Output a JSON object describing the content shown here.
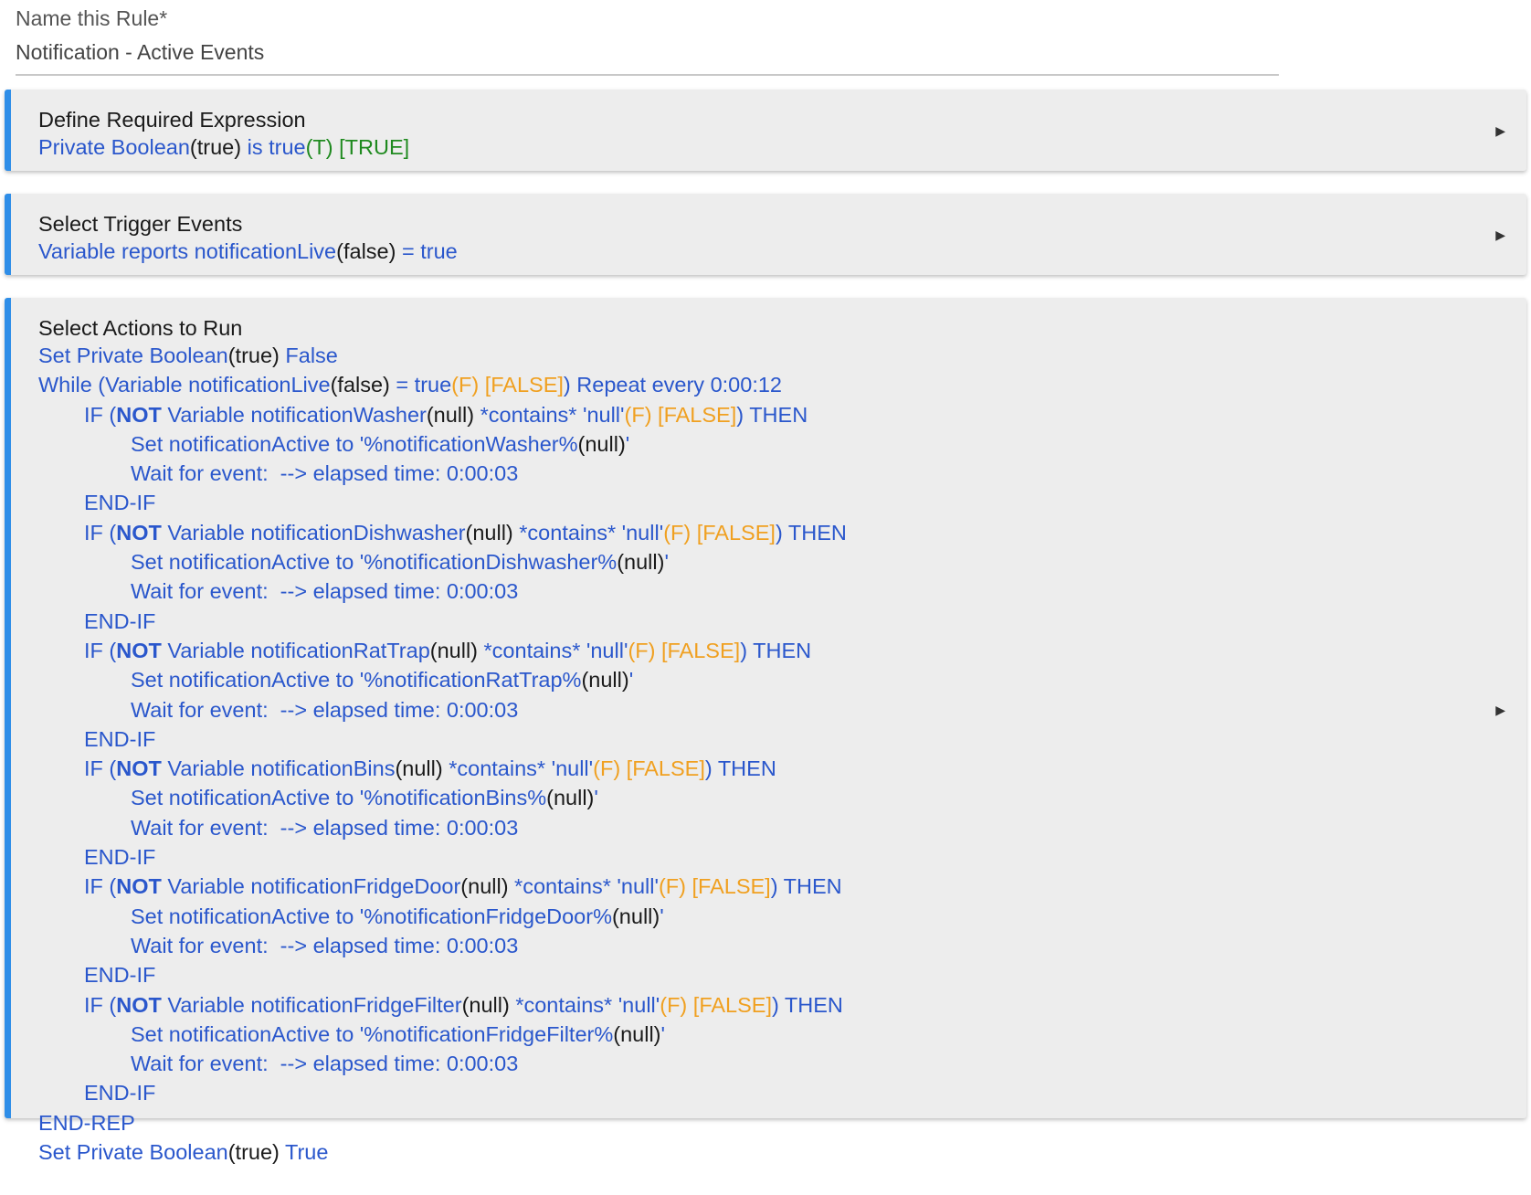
{
  "name_rule": {
    "label": "Name this Rule*",
    "value": "Notification - Active Events"
  },
  "required_expression": {
    "title": "Define Required Expression",
    "segments": [
      {
        "t": "Private Boolean",
        "c": "b"
      },
      {
        "t": "(true)",
        "c": "k"
      },
      {
        "t": " is true",
        "c": "b"
      },
      {
        "t": "(T) [TRUE]",
        "c": "g"
      }
    ]
  },
  "trigger_events": {
    "title": "Select Trigger Events",
    "segments": [
      {
        "t": "Variable reports notificationLive",
        "c": "b"
      },
      {
        "t": "(false)",
        "c": "k"
      },
      {
        "t": " = true",
        "c": "b"
      }
    ]
  },
  "actions": {
    "title": "Select Actions to Run",
    "lines": [
      {
        "indent": 0,
        "segments": [
          {
            "t": "Set Private Boolean",
            "c": "b"
          },
          {
            "t": "(true)",
            "c": "k"
          },
          {
            "t": " False",
            "c": "b"
          }
        ]
      },
      {
        "indent": 0,
        "segments": [
          {
            "t": "While (Variable notificationLive",
            "c": "b"
          },
          {
            "t": "(false)",
            "c": "k"
          },
          {
            "t": " = true",
            "c": "b"
          },
          {
            "t": "(F) [FALSE]",
            "c": "o"
          },
          {
            "t": ") Repeat every 0:00:12",
            "c": "b"
          }
        ]
      },
      {
        "indent": 1,
        "segments": [
          {
            "t": "IF (",
            "c": "b"
          },
          {
            "t": "NOT",
            "c": "b bold"
          },
          {
            "t": " Variable notificationWasher",
            "c": "b"
          },
          {
            "t": "(null)",
            "c": "k"
          },
          {
            "t": " *contains* 'null'",
            "c": "b"
          },
          {
            "t": "(F) [FALSE]",
            "c": "o"
          },
          {
            "t": ") THEN",
            "c": "b"
          }
        ]
      },
      {
        "indent": 2,
        "segments": [
          {
            "t": "Set notificationActive to '%notificationWasher%",
            "c": "b"
          },
          {
            "t": "(null)",
            "c": "k"
          },
          {
            "t": "'",
            "c": "b"
          }
        ]
      },
      {
        "indent": 2,
        "segments": [
          {
            "t": "Wait for event:  --> elapsed time: 0:00:03",
            "c": "b"
          }
        ]
      },
      {
        "indent": 1,
        "segments": [
          {
            "t": "END-IF",
            "c": "b"
          }
        ]
      },
      {
        "indent": 1,
        "segments": [
          {
            "t": "IF (",
            "c": "b"
          },
          {
            "t": "NOT",
            "c": "b bold"
          },
          {
            "t": " Variable notificationDishwasher",
            "c": "b"
          },
          {
            "t": "(null)",
            "c": "k"
          },
          {
            "t": " *contains* 'null'",
            "c": "b"
          },
          {
            "t": "(F) [FALSE]",
            "c": "o"
          },
          {
            "t": ") THEN",
            "c": "b"
          }
        ]
      },
      {
        "indent": 2,
        "segments": [
          {
            "t": "Set notificationActive to '%notificationDishwasher%",
            "c": "b"
          },
          {
            "t": "(null)",
            "c": "k"
          },
          {
            "t": "'",
            "c": "b"
          }
        ]
      },
      {
        "indent": 2,
        "segments": [
          {
            "t": "Wait for event:  --> elapsed time: 0:00:03",
            "c": "b"
          }
        ]
      },
      {
        "indent": 1,
        "segments": [
          {
            "t": "END-IF",
            "c": "b"
          }
        ]
      },
      {
        "indent": 1,
        "segments": [
          {
            "t": "IF (",
            "c": "b"
          },
          {
            "t": "NOT",
            "c": "b bold"
          },
          {
            "t": " Variable notificationRatTrap",
            "c": "b"
          },
          {
            "t": "(null)",
            "c": "k"
          },
          {
            "t": " *contains* 'null'",
            "c": "b"
          },
          {
            "t": "(F) [FALSE]",
            "c": "o"
          },
          {
            "t": ") THEN",
            "c": "b"
          }
        ]
      },
      {
        "indent": 2,
        "segments": [
          {
            "t": "Set notificationActive to '%notificationRatTrap%",
            "c": "b"
          },
          {
            "t": "(null)",
            "c": "k"
          },
          {
            "t": "'",
            "c": "b"
          }
        ]
      },
      {
        "indent": 2,
        "segments": [
          {
            "t": "Wait for event:  --> elapsed time: 0:00:03",
            "c": "b"
          }
        ]
      },
      {
        "indent": 1,
        "segments": [
          {
            "t": "END-IF",
            "c": "b"
          }
        ]
      },
      {
        "indent": 1,
        "segments": [
          {
            "t": "IF (",
            "c": "b"
          },
          {
            "t": "NOT",
            "c": "b bold"
          },
          {
            "t": " Variable notificationBins",
            "c": "b"
          },
          {
            "t": "(null)",
            "c": "k"
          },
          {
            "t": " *contains* 'null'",
            "c": "b"
          },
          {
            "t": "(F) [FALSE]",
            "c": "o"
          },
          {
            "t": ") THEN",
            "c": "b"
          }
        ]
      },
      {
        "indent": 2,
        "segments": [
          {
            "t": "Set notificationActive to '%notificationBins%",
            "c": "b"
          },
          {
            "t": "(null)",
            "c": "k"
          },
          {
            "t": "'",
            "c": "b"
          }
        ]
      },
      {
        "indent": 2,
        "segments": [
          {
            "t": "Wait for event:  --> elapsed time: 0:00:03",
            "c": "b"
          }
        ]
      },
      {
        "indent": 1,
        "segments": [
          {
            "t": "END-IF",
            "c": "b"
          }
        ]
      },
      {
        "indent": 1,
        "segments": [
          {
            "t": "IF (",
            "c": "b"
          },
          {
            "t": "NOT",
            "c": "b bold"
          },
          {
            "t": " Variable notificationFridgeDoor",
            "c": "b"
          },
          {
            "t": "(null)",
            "c": "k"
          },
          {
            "t": " *contains* 'null'",
            "c": "b"
          },
          {
            "t": "(F) [FALSE]",
            "c": "o"
          },
          {
            "t": ") THEN",
            "c": "b"
          }
        ]
      },
      {
        "indent": 2,
        "segments": [
          {
            "t": "Set notificationActive to '%notificationFridgeDoor%",
            "c": "b"
          },
          {
            "t": "(null)",
            "c": "k"
          },
          {
            "t": "'",
            "c": "b"
          }
        ]
      },
      {
        "indent": 2,
        "segments": [
          {
            "t": "Wait for event:  --> elapsed time: 0:00:03",
            "c": "b"
          }
        ]
      },
      {
        "indent": 1,
        "segments": [
          {
            "t": "END-IF",
            "c": "b"
          }
        ]
      },
      {
        "indent": 1,
        "segments": [
          {
            "t": "IF (",
            "c": "b"
          },
          {
            "t": "NOT",
            "c": "b bold"
          },
          {
            "t": " Variable notificationFridgeFilter",
            "c": "b"
          },
          {
            "t": "(null)",
            "c": "k"
          },
          {
            "t": " *contains* 'null'",
            "c": "b"
          },
          {
            "t": "(F) [FALSE]",
            "c": "o"
          },
          {
            "t": ") THEN",
            "c": "b"
          }
        ]
      },
      {
        "indent": 2,
        "segments": [
          {
            "t": "Set notificationActive to '%notificationFridgeFilter%",
            "c": "b"
          },
          {
            "t": "(null)",
            "c": "k"
          },
          {
            "t": "'",
            "c": "b"
          }
        ]
      },
      {
        "indent": 2,
        "segments": [
          {
            "t": "Wait for event:  --> elapsed time: 0:00:03",
            "c": "b"
          }
        ]
      },
      {
        "indent": 1,
        "segments": [
          {
            "t": "END-IF",
            "c": "b"
          }
        ]
      },
      {
        "indent": 0,
        "segments": [
          {
            "t": "END-REP",
            "c": "b"
          }
        ]
      },
      {
        "indent": 0,
        "segments": [
          {
            "t": "Set Private Boolean",
            "c": "b"
          },
          {
            "t": "(true)",
            "c": "k"
          },
          {
            "t": " True",
            "c": "b"
          }
        ]
      }
    ]
  },
  "icons": {
    "expand": "expand-arrow-icon"
  },
  "colors": {
    "accent_bar": "#2f8ee8",
    "keyword_blue": "#2a57cc",
    "true_green": "#1f8a1f",
    "false_orange": "#f0a020",
    "card_bg": "#ededed"
  }
}
